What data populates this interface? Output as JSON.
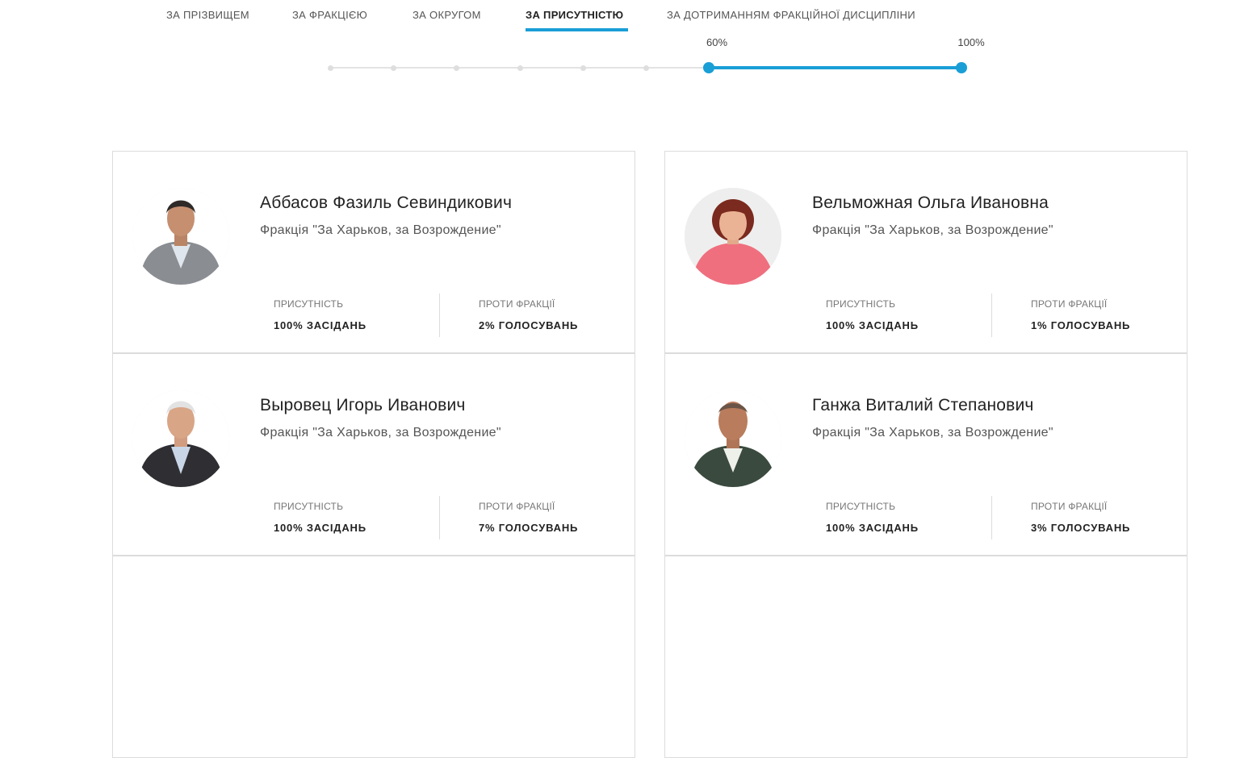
{
  "tabs": [
    {
      "label": "За прізвищем",
      "active": false
    },
    {
      "label": "За фракцією",
      "active": false
    },
    {
      "label": "За округом",
      "active": false
    },
    {
      "label": "За присутністю",
      "active": true
    },
    {
      "label": "За дотриманням фракційної дисципліни",
      "active": false
    }
  ],
  "filter": {
    "min_label": "60%",
    "max_label": "100%",
    "range_min_percent": 60,
    "range_max_percent": 100,
    "accent_color": "#1a9ed6"
  },
  "stat_labels": {
    "attendance": "Присутність",
    "against_faction": "Проти фракції"
  },
  "deputies": [
    {
      "name": "Аббасов Фазиль Севиндикович",
      "faction": "Фракція \"За Харьков, за Возрождение\"",
      "attendance": "100% засідань",
      "against_faction": "2% голосувань"
    },
    {
      "name": "Вельможная Ольга Ивановна",
      "faction": "Фракція \"За Харьков, за Возрождение\"",
      "attendance": "100% засідань",
      "against_faction": "1% голосувань"
    },
    {
      "name": "Выровец Игорь Иванович",
      "faction": "Фракція \"За Харьков, за Возрождение\"",
      "attendance": "100% засідань",
      "against_faction": "7% голосувань"
    },
    {
      "name": "Ганжа Виталий Степанович",
      "faction": "Фракція \"За Харьков, за Возрождение\"",
      "attendance": "100% засідань",
      "against_faction": "3% голосувань"
    }
  ]
}
